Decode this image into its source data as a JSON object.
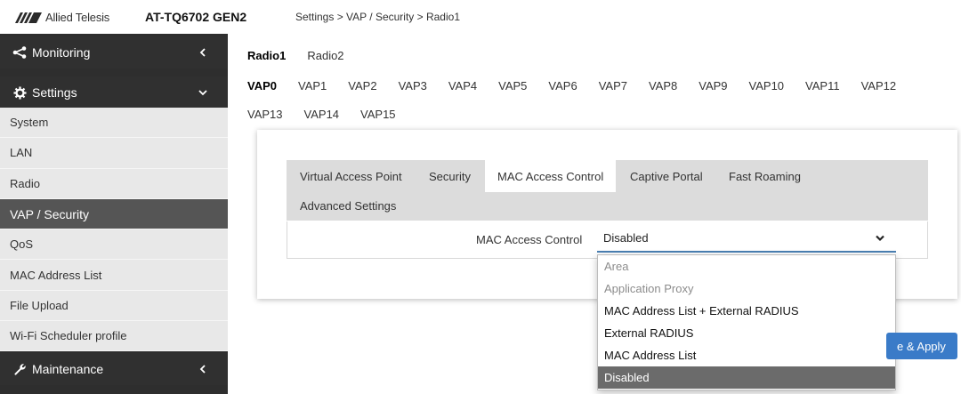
{
  "header": {
    "logo_text": "Allied Telesis",
    "product": "AT-TQ6702 GEN2",
    "breadcrumb": "Settings > VAP / Security > Radio1"
  },
  "sidebar": {
    "monitoring": {
      "label": "Monitoring",
      "icon": "share-icon"
    },
    "settings": {
      "label": "Settings",
      "icon": "gear-icon"
    },
    "items": [
      {
        "label": "System"
      },
      {
        "label": "LAN"
      },
      {
        "label": "Radio"
      },
      {
        "label": "VAP / Security",
        "active": true
      },
      {
        "label": "QoS"
      },
      {
        "label": "MAC Address List"
      },
      {
        "label": "File Upload"
      },
      {
        "label": "Wi-Fi Scheduler profile"
      }
    ],
    "maintenance": {
      "label": "Maintenance",
      "icon": "wrench-icon"
    }
  },
  "radio_tabs": [
    {
      "label": "Radio1",
      "active": true
    },
    {
      "label": "Radio2"
    }
  ],
  "vap_tabs_row1": [
    "VAP0",
    "VAP1",
    "VAP2",
    "VAP3",
    "VAP4",
    "VAP5",
    "VAP6",
    "VAP7",
    "VAP8",
    "VAP9",
    "VAP10",
    "VAP11",
    "VAP12"
  ],
  "vap_tabs_row2": [
    "VAP13",
    "VAP14",
    "VAP15"
  ],
  "vap_active": "VAP0",
  "inner_tabs": {
    "virtual_access_point": "Virtual Access Point",
    "security": "Security",
    "mac_access_control": "MAC Access Control",
    "captive_portal": "Captive Portal",
    "fast_roaming": "Fast Roaming",
    "advanced_settings": "Advanced Settings"
  },
  "form": {
    "mac_access_control_label": "MAC Access Control",
    "mac_access_control_value": "Disabled"
  },
  "dropdown_options": [
    {
      "label": "Area",
      "disabled": true
    },
    {
      "label": "Application Proxy",
      "disabled": true
    },
    {
      "label": "MAC Address List + External RADIUS"
    },
    {
      "label": "External RADIUS"
    },
    {
      "label": "MAC Address List"
    },
    {
      "label": "Disabled",
      "selected": true
    }
  ],
  "buttons": {
    "save_apply": "e & Apply"
  },
  "colors": {
    "sidebar_bg": "#2e2e2e",
    "sidebar_sub_bg": "#e8e8e8",
    "active_sub_bg": "#555555",
    "accent": "#3a7bc8",
    "select_underline": "#4a7fb2",
    "selected_option_bg": "#6b6b6b"
  }
}
